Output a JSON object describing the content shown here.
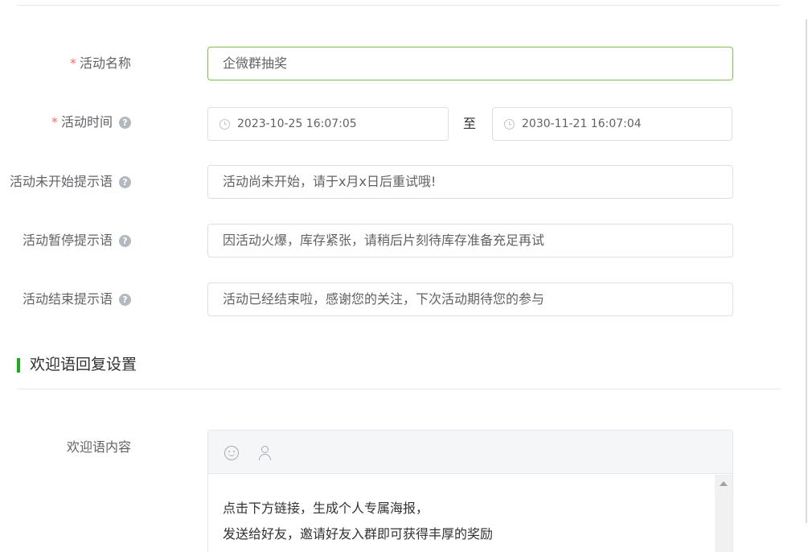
{
  "form": {
    "name": {
      "label": "活动名称",
      "value": "企微群抽奖",
      "required": "*"
    },
    "time": {
      "label": "活动时间",
      "required": "*",
      "start": "2023-10-25 16:07:05",
      "end": "2030-11-21 16:07:04",
      "separator": "至"
    },
    "not_started": {
      "label": "活动未开始提示语",
      "value": "活动尚未开始，请于x月x日后重试哦!"
    },
    "paused": {
      "label": "活动暂停提示语",
      "value": "因活动火爆，库存紧张，请稍后片刻待库存准备充足再试"
    },
    "ended": {
      "label": "活动结束提示语",
      "value": "活动已经结束啦，感谢您的关注，下次活动期待您的参与"
    },
    "help_glyph": "?"
  },
  "welcome": {
    "section_title": "欢迎语回复设置",
    "content_label": "欢迎语内容",
    "lines": [
      "点击下方链接，生成个人专属海报，",
      "发送给好友，邀请好友入群即可获得丰厚的奖励"
    ]
  },
  "colors": {
    "accent": "#1aad19",
    "focus_border": "#7ec050",
    "required": "#f56c6c"
  }
}
